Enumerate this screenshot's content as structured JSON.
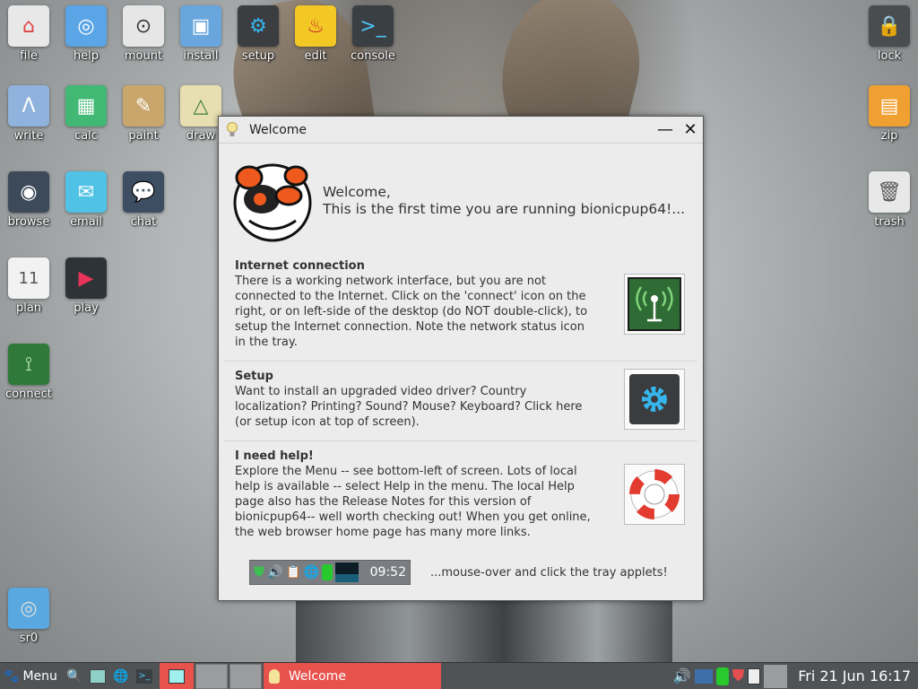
{
  "desktop": {
    "left_icons": [
      {
        "id": "file",
        "label": "file",
        "icon": "home-folder-icon",
        "color": "#e8e8e8"
      },
      {
        "id": "help",
        "label": "help",
        "icon": "lifebuoy-icon",
        "color": "#5aa5e6"
      },
      {
        "id": "mount",
        "label": "mount",
        "icon": "drive-icon",
        "color": "#e6e6e6"
      },
      {
        "id": "install",
        "label": "install",
        "icon": "package-icon",
        "color": "#6aa6de"
      },
      {
        "id": "setup",
        "label": "setup",
        "icon": "gear-icon",
        "color": "#3b3d40"
      },
      {
        "id": "edit",
        "label": "edit",
        "icon": "genie-lamp-icon",
        "color": "#f3c824"
      },
      {
        "id": "console",
        "label": "console",
        "icon": "terminal-icon",
        "color": "#3a3f44"
      },
      {
        "id": "write",
        "label": "write",
        "icon": "write-icon",
        "color": "#8fb3dc"
      },
      {
        "id": "calc",
        "label": "calc",
        "icon": "spreadsheet-icon",
        "color": "#41b874"
      },
      {
        "id": "paint",
        "label": "paint",
        "icon": "palette-icon",
        "color": "#c9a66b"
      },
      {
        "id": "draw",
        "label": "draw",
        "icon": "draw-icon",
        "color": "#e7dfb2"
      },
      {
        "id": "browse",
        "label": "browse",
        "icon": "globe-icon",
        "color": "#3c4a5a"
      },
      {
        "id": "email",
        "label": "email",
        "icon": "envelope-icon",
        "color": "#4fc2e6"
      },
      {
        "id": "chat",
        "label": "chat",
        "icon": "chat-bubbles-icon",
        "color": "#3d4d62"
      },
      {
        "id": "plan",
        "label": "plan",
        "icon": "calendar-icon",
        "color": "#f2f2f2",
        "day": "11"
      },
      {
        "id": "play",
        "label": "play",
        "icon": "media-play-icon",
        "color": "#2e3338"
      },
      {
        "id": "connect",
        "label": "connect",
        "icon": "antenna-icon",
        "color": "#2f7a3a"
      },
      {
        "id": "sr0",
        "label": "sr0",
        "icon": "optical-disc-icon",
        "color": "#59a8e0"
      }
    ],
    "right_icons": [
      {
        "id": "lock",
        "label": "lock",
        "icon": "padlock-icon",
        "color": "#4a4d50"
      },
      {
        "id": "zip",
        "label": "zip",
        "icon": "archive-icon",
        "color": "#f0a030"
      },
      {
        "id": "trash",
        "label": "trash",
        "icon": "trash-can-icon",
        "color": "#e8e8e8"
      }
    ]
  },
  "welcome_window": {
    "title": "Welcome",
    "minimize_glyph": "—",
    "close_glyph": "✕",
    "greeting_line1": "Welcome,",
    "greeting_line2": "This is the first time you are running bionicpup64!...",
    "sections": [
      {
        "heading": "Internet connection",
        "text": "There is a working network interface, but you are not connected to the Internet. Click on the 'connect' icon on the right, or on left-side of the desktop (do NOT double-click), to setup the Internet connection. Note the network status icon in the tray.",
        "button_icon": "antenna-icon"
      },
      {
        "heading": "Setup",
        "text": "Want to install an upgraded video driver? Country localization? Printing? Sound? Mouse? Keyboard? Click here (or setup icon at top of screen).",
        "button_icon": "gear-icon"
      },
      {
        "heading": "I need help!",
        "text": "Explore the Menu -- see bottom-left of screen. Lots of local help is available -- select Help in the menu. The local Help page also has the Release Notes for this version of bionicpup64-- well worth checking out! When you get online, the web browser home page has many more links.",
        "button_icon": "lifebuoy-icon"
      }
    ],
    "tray_preview_clock": "09:52",
    "tray_hint": "...mouse-over and click the tray applets!"
  },
  "taskbar": {
    "menu_label": "Menu",
    "active_task": "Welcome",
    "clock": "Fri 21 Jun 16:17"
  },
  "colors": {
    "accent_red": "#e8524d",
    "taskbar_bg": "#4f5356",
    "window_bg": "#ececec"
  }
}
